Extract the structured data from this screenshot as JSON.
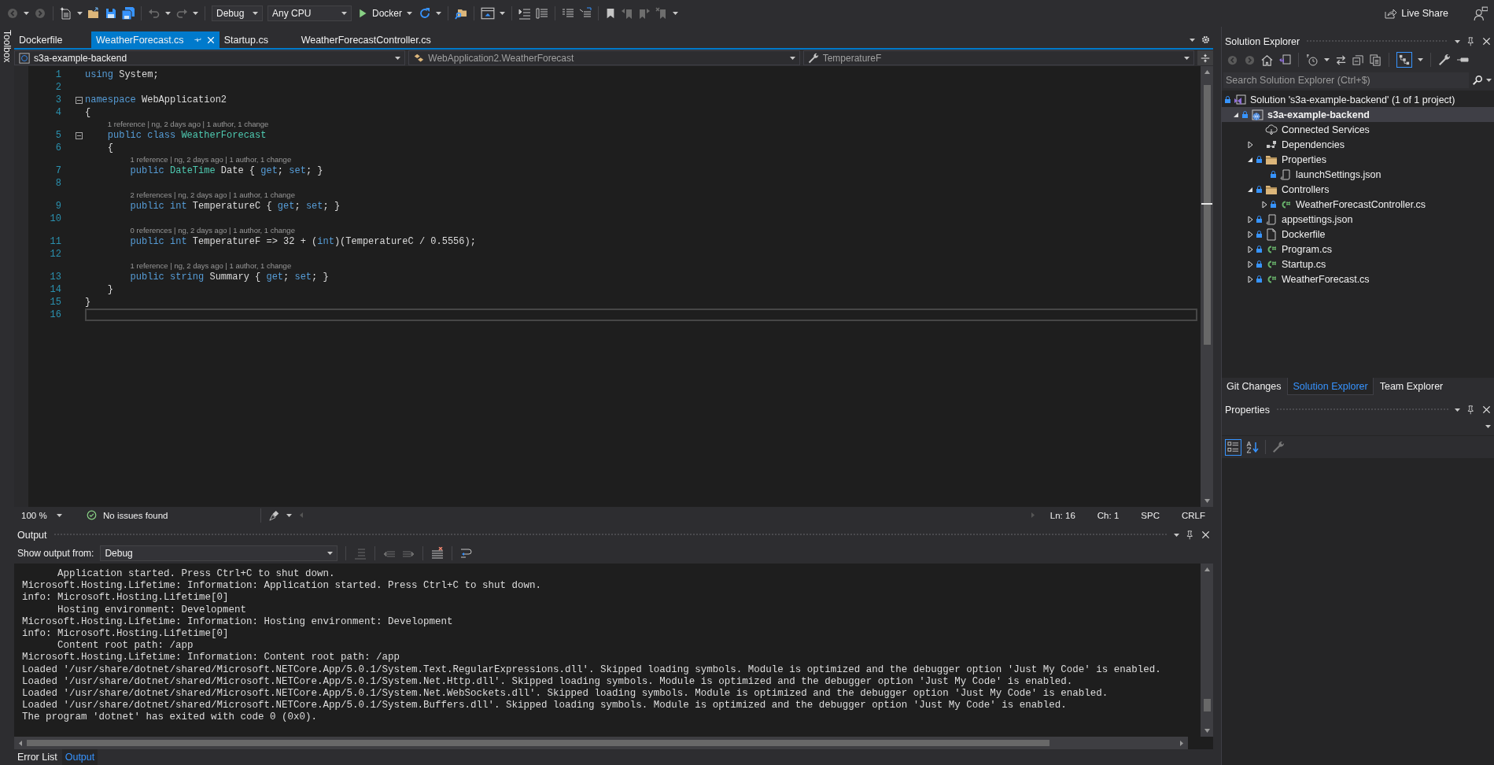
{
  "toolbar": {
    "configuration": "Debug",
    "platform": "Any CPU",
    "launch_target": "Docker",
    "live_share": "Live Share"
  },
  "toolbox": {
    "label": "Toolbox"
  },
  "document_tabs": [
    {
      "label": "Dockerfile",
      "selected": false
    },
    {
      "label": "WeatherForecast.cs",
      "selected": true
    },
    {
      "label": "Startup.cs",
      "selected": false
    },
    {
      "label": "WeatherForecastController.cs",
      "selected": false
    }
  ],
  "navigation_bar": {
    "project": "s3a-example-backend",
    "type": "WebApplication2.WeatherForecast",
    "member": "TemperatureF"
  },
  "editor": {
    "lines": [
      {
        "number": "1",
        "collapsible": false,
        "current": false,
        "segments": [
          {
            "kind": "keyword",
            "text": "using"
          },
          {
            "kind": "plain",
            "text": " System;"
          }
        ]
      },
      {
        "number": "2",
        "collapsible": false,
        "current": false
      },
      {
        "number": "3",
        "collapsible": true,
        "current": false,
        "segments": [
          {
            "kind": "keyword",
            "text": "namespace"
          },
          {
            "kind": "plain",
            "text": " WebApplication2"
          }
        ]
      },
      {
        "number": "4",
        "collapsible": false,
        "current": false,
        "segments": [
          {
            "kind": "plain",
            "text": "{"
          }
        ]
      },
      {
        "number": "5",
        "collapsible": true,
        "current": false,
        "lens": "1 reference | ng, 2 days ago | 1 author, 1 change",
        "segments": [
          {
            "kind": "keyword",
            "text": "    public class "
          },
          {
            "kind": "type",
            "text": "WeatherForecast"
          }
        ]
      },
      {
        "number": "6",
        "collapsible": false,
        "current": false,
        "segments": [
          {
            "kind": "plain",
            "text": "    {"
          }
        ]
      },
      {
        "number": "7",
        "collapsible": false,
        "current": false,
        "lens": "1 reference | ng, 2 days ago | 1 author, 1 change",
        "segments": [
          {
            "kind": "keyword",
            "text": "        public "
          },
          {
            "kind": "type",
            "text": "DateTime"
          },
          {
            "kind": "plain",
            "text": " Date { "
          },
          {
            "kind": "keyword",
            "text": "get"
          },
          {
            "kind": "plain",
            "text": "; "
          },
          {
            "kind": "keyword",
            "text": "set"
          },
          {
            "kind": "plain",
            "text": "; }"
          }
        ]
      },
      {
        "number": "8",
        "collapsible": false,
        "current": false
      },
      {
        "number": "9",
        "collapsible": false,
        "current": false,
        "lens": "2 references | ng, 2 days ago | 1 author, 1 change",
        "segments": [
          {
            "kind": "keyword",
            "text": "        public int "
          },
          {
            "kind": "plain",
            "text": "TemperatureC { "
          },
          {
            "kind": "keyword",
            "text": "get"
          },
          {
            "kind": "plain",
            "text": "; "
          },
          {
            "kind": "keyword",
            "text": "set"
          },
          {
            "kind": "plain",
            "text": "; }"
          }
        ]
      },
      {
        "number": "10",
        "collapsible": false,
        "current": false
      },
      {
        "number": "11",
        "collapsible": false,
        "current": false,
        "lens": "0 references | ng, 2 days ago | 1 author, 1 change",
        "segments": [
          {
            "kind": "keyword",
            "text": "        public int "
          },
          {
            "kind": "plain",
            "text": "TemperatureF => 32 + ("
          },
          {
            "kind": "keyword",
            "text": "int"
          },
          {
            "kind": "plain",
            "text": ")(TemperatureC / 0.5556);"
          }
        ]
      },
      {
        "number": "12",
        "collapsible": false,
        "current": false
      },
      {
        "number": "13",
        "collapsible": false,
        "current": false,
        "lens": "1 reference | ng, 2 days ago | 1 author, 1 change",
        "segments": [
          {
            "kind": "keyword",
            "text": "        public string "
          },
          {
            "kind": "plain",
            "text": "Summary { "
          },
          {
            "kind": "keyword",
            "text": "get"
          },
          {
            "kind": "plain",
            "text": "; "
          },
          {
            "kind": "keyword",
            "text": "set"
          },
          {
            "kind": "plain",
            "text": "; }"
          }
        ]
      },
      {
        "number": "14",
        "collapsible": false,
        "current": false,
        "segments": [
          {
            "kind": "plain",
            "text": "    }"
          }
        ]
      },
      {
        "number": "15",
        "collapsible": false,
        "current": false,
        "segments": [
          {
            "kind": "plain",
            "text": "}"
          }
        ]
      },
      {
        "number": "16",
        "collapsible": false,
        "current": true
      }
    ]
  },
  "editor_status": {
    "zoom": "100 %",
    "issues": "No issues found",
    "line": "Ln: 16",
    "column": "Ch: 1",
    "whitespace": "SPC",
    "line_endings": "CRLF"
  },
  "output": {
    "title": "Output",
    "source_label": "Show output from:",
    "source": "Debug",
    "lines": [
      "      Application started. Press Ctrl+C to shut down.",
      "Microsoft.Hosting.Lifetime: Information: Application started. Press Ctrl+C to shut down.",
      "info: Microsoft.Hosting.Lifetime[0]",
      "      Hosting environment: Development",
      "Microsoft.Hosting.Lifetime: Information: Hosting environment: Development",
      "info: Microsoft.Hosting.Lifetime[0]",
      "      Content root path: /app",
      "Microsoft.Hosting.Lifetime: Information: Content root path: /app",
      "Loaded '/usr/share/dotnet/shared/Microsoft.NETCore.App/5.0.1/System.Text.RegularExpressions.dll'. Skipped loading symbols. Module is optimized and the debugger option 'Just My Code' is enabled.",
      "Loaded '/usr/share/dotnet/shared/Microsoft.NETCore.App/5.0.1/System.Net.Http.dll'. Skipped loading symbols. Module is optimized and the debugger option 'Just My Code' is enabled.",
      "Loaded '/usr/share/dotnet/shared/Microsoft.NETCore.App/5.0.1/System.Net.WebSockets.dll'. Skipped loading symbols. Module is optimized and the debugger option 'Just My Code' is enabled.",
      "Loaded '/usr/share/dotnet/shared/Microsoft.NETCore.App/5.0.1/System.Buffers.dll'. Skipped loading symbols. Module is optimized and the debugger option 'Just My Code' is enabled.",
      "The program 'dotnet' has exited with code 0 (0x0)."
    ]
  },
  "bottom_tabs": [
    {
      "label": "Error List",
      "selected": false
    },
    {
      "label": "Output",
      "selected": true
    }
  ],
  "solution_explorer": {
    "title": "Solution Explorer",
    "search_placeholder": "Search Solution Explorer (Ctrl+$)",
    "tree": [
      {
        "label": "Solution 's3a-example-backend' (1 of 1 project)",
        "kind": "solution",
        "locked": true,
        "selected": false,
        "children": [
          {
            "label": "s3a-example-backend",
            "kind": "project",
            "locked": true,
            "selected": true,
            "expanded": true,
            "children": [
              {
                "label": "Connected Services",
                "kind": "connected-services",
                "locked": false,
                "selected": false
              },
              {
                "label": "Dependencies",
                "kind": "dependencies",
                "locked": false,
                "selected": false,
                "expanded": false
              },
              {
                "label": "Properties",
                "kind": "folder",
                "locked": true,
                "selected": false,
                "expanded": true,
                "children": [
                  {
                    "label": "launchSettings.json",
                    "kind": "json",
                    "locked": true,
                    "selected": false
                  }
                ]
              },
              {
                "label": "Controllers",
                "kind": "folder",
                "locked": true,
                "selected": false,
                "expanded": true,
                "children": [
                  {
                    "label": "WeatherForecastController.cs",
                    "kind": "csharp",
                    "locked": true,
                    "selected": false,
                    "expanded": false
                  }
                ]
              },
              {
                "label": "appsettings.json",
                "kind": "json",
                "locked": true,
                "selected": false,
                "expanded": false
              },
              {
                "label": "Dockerfile",
                "kind": "file",
                "locked": true,
                "selected": false,
                "expanded": false
              },
              {
                "label": "Program.cs",
                "kind": "csharp",
                "locked": true,
                "selected": false,
                "expanded": false
              },
              {
                "label": "Startup.cs",
                "kind": "csharp",
                "locked": true,
                "selected": false,
                "expanded": false
              },
              {
                "label": "WeatherForecast.cs",
                "kind": "csharp",
                "locked": true,
                "selected": false,
                "expanded": false
              }
            ]
          }
        ]
      }
    ],
    "tabs": [
      {
        "label": "Git Changes",
        "selected": false
      },
      {
        "label": "Solution Explorer",
        "selected": true
      },
      {
        "label": "Team Explorer",
        "selected": false
      }
    ]
  },
  "properties": {
    "title": "Properties"
  }
}
